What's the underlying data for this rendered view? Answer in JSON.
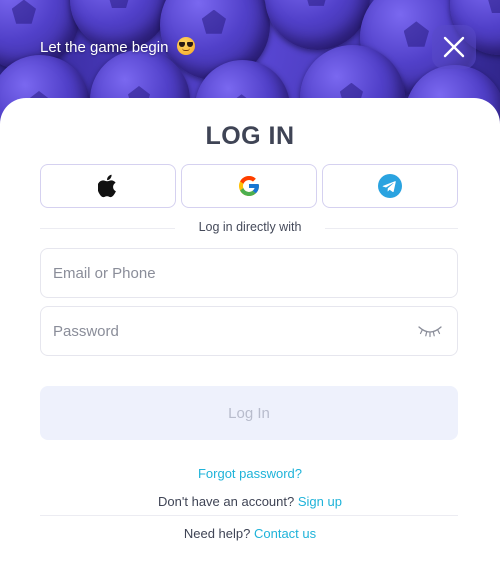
{
  "header": {
    "greeting": "Let the game begin",
    "emoji_icon": "smiling-face-with-sunglasses",
    "close_icon": "close-icon"
  },
  "login": {
    "title": "LOG IN",
    "social_providers": [
      {
        "name": "Apple",
        "icon": "apple-icon"
      },
      {
        "name": "Google",
        "icon": "google-icon"
      },
      {
        "name": "Telegram",
        "icon": "telegram-icon"
      }
    ],
    "divider_text": "Log in directly with",
    "email": {
      "placeholder": "Email or Phone",
      "value": ""
    },
    "password": {
      "placeholder": "Password",
      "value": "",
      "toggle_icon": "eye-closed-icon"
    },
    "submit_label": "Log In",
    "forgot_password": "Forgot password?",
    "signup_prompt": "Don't have an account?",
    "signup_link": "Sign up",
    "help_prompt": "Need help?",
    "help_link": "Contact us"
  },
  "colors": {
    "accent_link": "#1fb3d9",
    "hero_purple": "#4a3bc0",
    "button_disabled_bg": "#eef1fc",
    "title_text": "#3f4455"
  }
}
